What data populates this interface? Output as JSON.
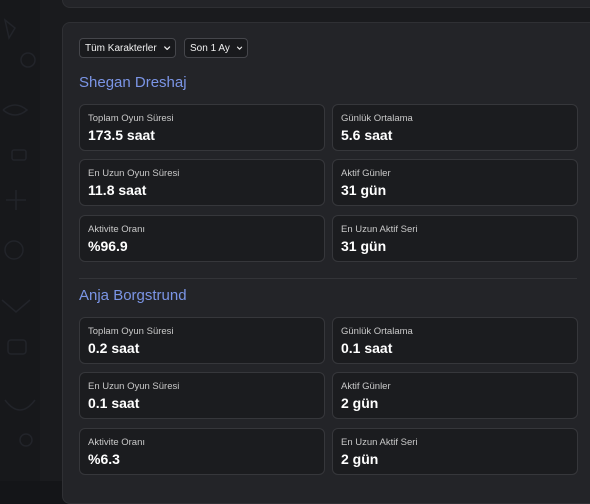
{
  "filters": {
    "character": "Tüm Karakterler",
    "period": "Son 1 Ay"
  },
  "characters": [
    {
      "name": "Shegan Dreshaj",
      "stats": {
        "total_label": "Toplam Oyun Süresi",
        "total_value": "173.5 saat",
        "daily_label": "Günlük Ortalama",
        "daily_value": "5.6 saat",
        "longest_label": "En Uzun Oyun Süresi",
        "longest_value": "11.8 saat",
        "active_label": "Aktif Günler",
        "active_value": "31 gün",
        "rate_label": "Aktivite Oranı",
        "rate_value": "%96.9",
        "streak_label": "En Uzun Aktif Seri",
        "streak_value": "31 gün"
      }
    },
    {
      "name": "Anja Borgstrund",
      "stats": {
        "total_label": "Toplam Oyun Süresi",
        "total_value": "0.2 saat",
        "daily_label": "Günlük Ortalama",
        "daily_value": "0.1 saat",
        "longest_label": "En Uzun Oyun Süresi",
        "longest_value": "0.1 saat",
        "active_label": "Aktif Günler",
        "active_value": "2 gün",
        "rate_label": "Aktivite Oranı",
        "rate_value": "%6.3",
        "streak_label": "En Uzun Aktif Seri",
        "streak_value": "2 gün"
      }
    }
  ],
  "icons": {
    "dropdown": "chevron-down-icon"
  },
  "colors": {
    "accent": "#7b95e6",
    "card_bg": "#1b1c1f",
    "panel_bg": "#232428"
  }
}
